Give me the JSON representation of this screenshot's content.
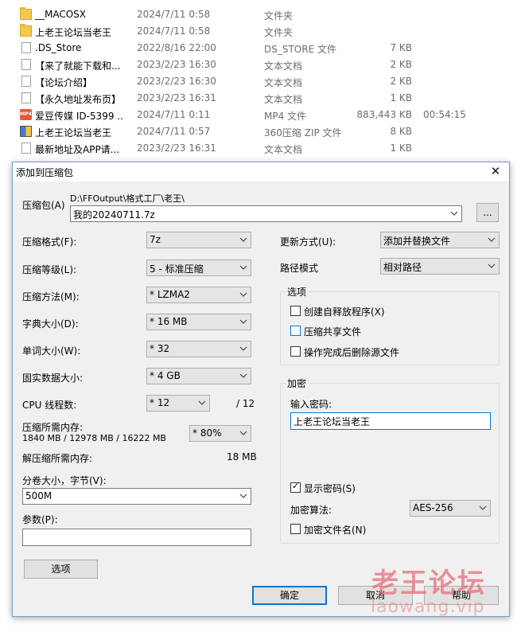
{
  "files": [
    {
      "name": "__MACOSX",
      "date": "2024/7/11 0:58",
      "type": "文件夹",
      "size": "",
      "length": "",
      "icon": "folder-icon"
    },
    {
      "name": "上老王论坛当老王",
      "date": "2024/7/11 0:58",
      "type": "文件夹",
      "size": "",
      "length": "",
      "icon": "folder-icon"
    },
    {
      "name": ".DS_Store",
      "date": "2022/8/16 22:00",
      "type": "DS_STORE 文件",
      "size": "7 KB",
      "length": "",
      "icon": "file-icon"
    },
    {
      "name": "【来了就能下载和...",
      "date": "2023/2/23 16:30",
      "type": "文本文档",
      "size": "2 KB",
      "length": "",
      "icon": "file-icon"
    },
    {
      "name": "【论坛介绍】",
      "date": "2023/2/23 16:30",
      "type": "文本文档",
      "size": "2 KB",
      "length": "",
      "icon": "file-icon"
    },
    {
      "name": "【永久地址发布页】",
      "date": "2023/2/23 16:31",
      "type": "文本文档",
      "size": "1 KB",
      "length": "",
      "icon": "file-icon"
    },
    {
      "name": "爱豆传媒 ID-5399 ...",
      "date": "2024/7/11 0:11",
      "type": "MP4 文件",
      "size": "883,443 KB",
      "length": "00:54:15",
      "icon": "mp4-icon"
    },
    {
      "name": "上老王论坛当老王",
      "date": "2024/7/11 0:57",
      "type": "360压缩 ZIP 文件",
      "size": "8 KB",
      "length": "",
      "icon": "zip-icon"
    },
    {
      "name": "最新地址及APP请...",
      "date": "2023/2/23 16:31",
      "type": "文本文档",
      "size": "1 KB",
      "length": "",
      "icon": "file-icon"
    }
  ],
  "dialog": {
    "title": "添加到压缩包",
    "close": "✕",
    "archive_label": "压缩包(A)",
    "archive_path": "D:\\FFOutput\\格式工厂\\老王\\",
    "archive_name": "我的20240711.7z",
    "browse_label": "...",
    "left": {
      "format_label": "压缩格式(F):",
      "format_value": "7z",
      "level_label": "压缩等级(L):",
      "level_value": "5 - 标准压缩",
      "method_label": "压缩方法(M):",
      "method_value": "*  LZMA2",
      "dict_label": "字典大小(D):",
      "dict_value": "*  16 MB",
      "word_label": "单词大小(W):",
      "word_value": "*  32",
      "solid_label": "固实数据大小:",
      "solid_value": "*  4 GB",
      "threads_label": "CPU 线程数:",
      "threads_value": "*  12",
      "threads_max": "/ 12",
      "mem_comp_label": "压缩所需内存:",
      "mem_comp_value": "1840 MB / 12978 MB / 16222 MB",
      "mem_percent": "* 80%",
      "mem_decomp_label": "解压缩所需内存:",
      "mem_decomp_value": "18 MB",
      "split_label": "分卷大小，字节(V):",
      "split_value": "500M",
      "params_label": "参数(P):",
      "params_value": "",
      "options_button": "选项"
    },
    "right": {
      "update_label": "更新方式(U):",
      "update_value": "添加并替换文件",
      "path_label": "路径模式",
      "path_value": "相对路径",
      "options_group": "选项",
      "opt_sfx": "创建自释放程序(X)",
      "opt_shared": "压缩共享文件",
      "opt_delete": "操作完成后删除源文件",
      "encrypt_group": "加密",
      "password_label": "输入密码:",
      "password_value": "上老王论坛当老王",
      "show_password": "显示密码(S)",
      "algo_label": "加密算法:",
      "algo_value": "AES-256",
      "encrypt_names": "加密文件名(N)"
    },
    "buttons": {
      "ok": "确定",
      "cancel": "取消",
      "help": "帮助"
    }
  },
  "watermark": {
    "cn": "老王论坛",
    "en": "laowang.vip"
  }
}
